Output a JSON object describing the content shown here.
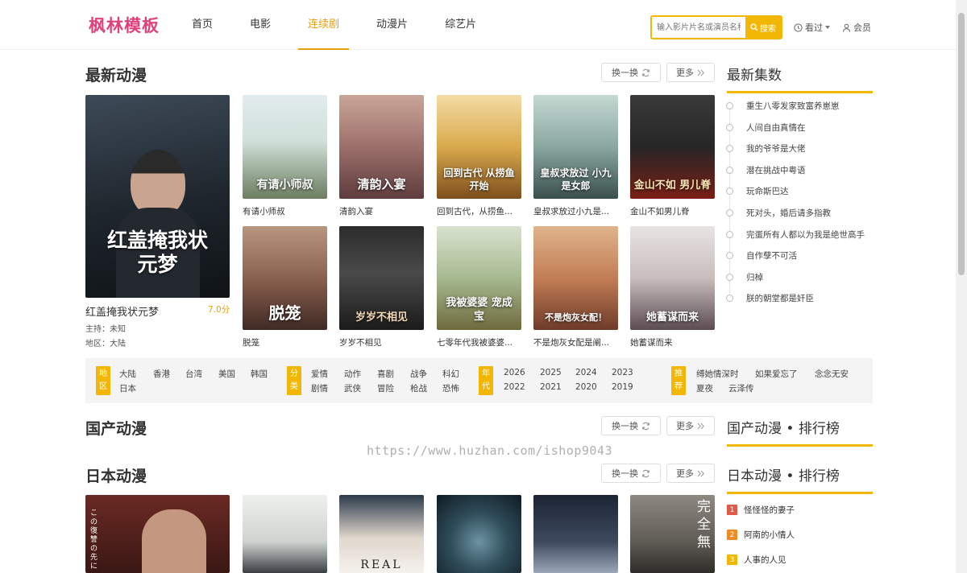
{
  "header": {
    "logo": "枫林模板",
    "nav": [
      "首页",
      "电影",
      "连续剧",
      "动漫片",
      "综艺片"
    ],
    "active_nav": "连续剧",
    "search_placeholder": "输入影片片名或演员名称",
    "search_button": "搜索",
    "history": "看过",
    "member": "会员"
  },
  "latest": {
    "title": "最新动漫",
    "swap": "换一换",
    "more": "更多",
    "featured": {
      "poster_text": "红盖掩我状元梦",
      "title": "红盖掩我状元梦",
      "score": "7.0分",
      "host": "主持：未知",
      "region": "地区：大陆"
    },
    "items": [
      {
        "title": "有请小师叔",
        "poster_text": "有请小师叔"
      },
      {
        "title": "清韵入宴",
        "poster_text": "清韵入宴"
      },
      {
        "title": "回到古代，从捞鱼...",
        "poster_text": "回到古代 从捞鱼开始"
      },
      {
        "title": "皇叔求放过小九是...",
        "poster_text": "皇叔求放过 小九是女郎"
      },
      {
        "title": "金山不如男儿脊",
        "poster_text": "金山不如 男儿脊"
      },
      {
        "title": "脱笼",
        "poster_text": "脱笼"
      },
      {
        "title": "岁岁不相见",
        "poster_text": "岁岁不相见"
      },
      {
        "title": "七零年代我被婆婆...",
        "poster_text": "我被婆婆 宠成宝"
      },
      {
        "title": "不是炮灰女配是阐...",
        "poster_text": "不是炮灰女配！"
      },
      {
        "title": "她蓄谋而来",
        "poster_text": "她蓄谋而来"
      }
    ]
  },
  "sidebar_latest": {
    "title": "最新集数",
    "items": [
      "重生八零发家致富养崽崽",
      "人间自由真情在",
      "我的爷爷是大佬",
      "潜在挑战中粤语",
      "玩命斯巴达",
      "死对头，婚后请多指教",
      "完蛋所有人都以为我是绝世高手",
      "自作孽不可活",
      "归棹",
      "朕的朝堂都是奸臣"
    ]
  },
  "filter": {
    "region": {
      "label": [
        "地",
        "区"
      ],
      "options": [
        "大陆",
        "香港",
        "台湾",
        "美国",
        "韩国",
        "日本"
      ]
    },
    "genre": {
      "label": [
        "分",
        "类"
      ],
      "options": [
        "爱情",
        "动作",
        "喜剧",
        "战争",
        "科幻",
        "剧情",
        "武侠",
        "冒险",
        "枪战",
        "恐怖"
      ]
    },
    "year": {
      "label": [
        "年",
        "代"
      ],
      "options": [
        "2026",
        "2025",
        "2024",
        "2023",
        "2022",
        "2021",
        "2020",
        "2019"
      ]
    },
    "recommend": {
      "label": [
        "推",
        "荐"
      ],
      "options": [
        "缚她情深时",
        "如果爱忘了",
        "念念无安",
        "夏夜",
        "云泽传"
      ]
    }
  },
  "domestic": {
    "title": "国产动漫",
    "swap": "换一换",
    "more": "更多",
    "rank_title": "国产动漫 • 排行榜"
  },
  "japanese": {
    "title": "日本动漫",
    "swap": "换一换",
    "more": "更多",
    "rank_title": "日本动漫 • 排行榜",
    "rank": [
      {
        "num": "1",
        "title": "怪怪怪的妻子"
      },
      {
        "num": "2",
        "title": "阿南的小情人"
      },
      {
        "num": "3",
        "title": "人事的人见"
      }
    ],
    "poster_texts": [
      "この復讐の先に",
      "",
      "REAL",
      "",
      "",
      "完全無"
    ]
  },
  "watermark": "https://www.huzhan.com/ishop9043",
  "colors": {
    "accent": "#f2b705",
    "logo": "#e0417a",
    "active_nav": "#e5a00d",
    "rank_1": "#e05a47",
    "rank_2": "#f08a24",
    "rank_3": "#f2b705"
  }
}
